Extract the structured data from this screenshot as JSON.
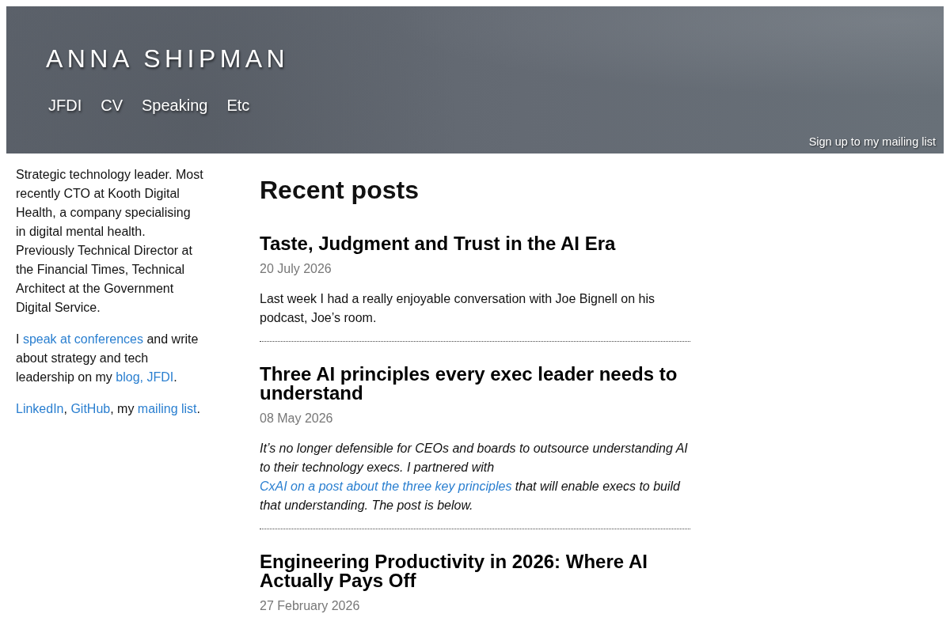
{
  "header": {
    "site_title": "ANNA SHIPMAN",
    "nav": [
      "JFDI",
      "CV",
      "Speaking",
      "Etc"
    ],
    "mailing_list_link": "Sign up to my mailing list"
  },
  "sidebar": {
    "paragraphs": [
      [
        {
          "kind": "text",
          "text": "Strategic technology leader. Most recently CTO at Kooth Digital Health, a company specialising in digital mental health. Previously Technical Director at the Financial Times, Technical Architect at the Government Digital Service."
        }
      ],
      [
        {
          "kind": "text",
          "text": "I "
        },
        {
          "kind": "link",
          "text": "speak at conferences"
        },
        {
          "kind": "text",
          "text": " and write about strategy and tech leadership on my "
        },
        {
          "kind": "link",
          "text": "blog, JFDI"
        },
        {
          "kind": "text",
          "text": "."
        }
      ],
      [
        {
          "kind": "link",
          "text": "LinkedIn"
        },
        {
          "kind": "text",
          "text": ", "
        },
        {
          "kind": "link",
          "text": "GitHub"
        },
        {
          "kind": "text",
          "text": ", my "
        },
        {
          "kind": "link",
          "text": "mailing list"
        },
        {
          "kind": "text",
          "text": "."
        }
      ]
    ]
  },
  "main": {
    "heading": "Recent posts",
    "posts": [
      {
        "title": "Taste, Judgment and Trust in the AI Era",
        "date": "20 July 2026",
        "excerpt_italic": false,
        "excerpt": [
          {
            "kind": "text",
            "text": "Last week I had a really enjoyable conversation with Joe Bignell on his podcast, Joe’s room."
          }
        ]
      },
      {
        "title": "Three AI principles every exec leader needs to understand",
        "date": "08 May 2026",
        "excerpt_italic": true,
        "excerpt": [
          {
            "kind": "text",
            "text": "It’s no longer defensible for CEOs and boards to outsource understanding AI to their technology execs. I partnered with "
          },
          {
            "kind": "link",
            "text": "CxAI on a post about the three key principles"
          },
          {
            "kind": "text",
            "text": " that will enable execs to build that understanding. The post is below."
          }
        ]
      },
      {
        "title": "Engineering Productivity in 2026: Where AI Actually Pays Off",
        "date": "27 February 2026"
      }
    ]
  }
}
